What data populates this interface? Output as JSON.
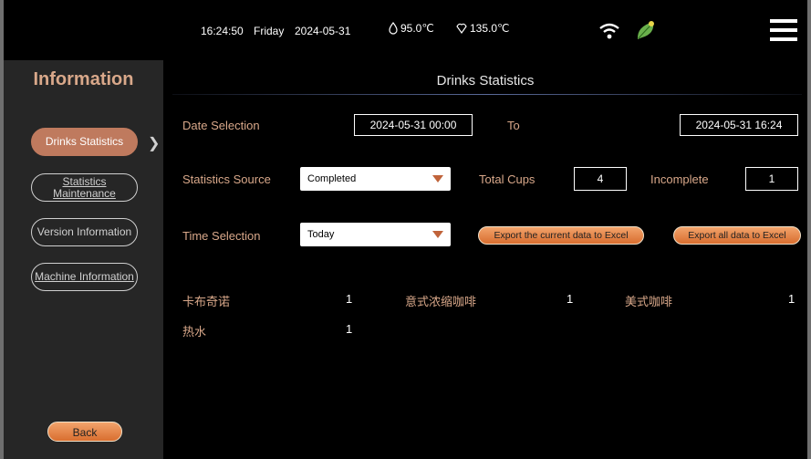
{
  "status": {
    "time": "16:24:50",
    "day": "Friday",
    "date": "2024-05-31",
    "temp1": "95.0℃",
    "temp2": "135.0℃"
  },
  "sidebar": {
    "title": "Information",
    "items": [
      {
        "label": "Drinks Statistics"
      },
      {
        "label": "Statistics Maintenance"
      },
      {
        "label": "Version Information"
      },
      {
        "label": "Machine Information"
      }
    ],
    "back_label": "Back"
  },
  "main": {
    "title": "Drinks Statistics",
    "date_selection_label": "Date Selection",
    "date_from": "2024-05-31 00:00",
    "to_label": "To",
    "date_to": "2024-05-31 16:24",
    "source_label": "Statistics Source",
    "source_value": "Completed",
    "total_cups_label": "Total Cups",
    "total_cups": "4",
    "incomplete_label": "Incomplete",
    "incomplete": "1",
    "time_selection_label": "Time Selection",
    "time_value": "Today",
    "export_current_label": "Export the current data to Excel",
    "export_all_label": "Export all data to Excel",
    "drinks": [
      {
        "name": "卡布奇诺",
        "count": "1"
      },
      {
        "name": "意式浓缩咖啡",
        "count": "1"
      },
      {
        "name": "美式咖啡",
        "count": "1"
      },
      {
        "name": "热水",
        "count": "1"
      }
    ]
  },
  "colors": {
    "accent": "#bf7a5e",
    "label": "#d9a88a",
    "button": "#e08845",
    "leaf": "#6ab04c"
  }
}
